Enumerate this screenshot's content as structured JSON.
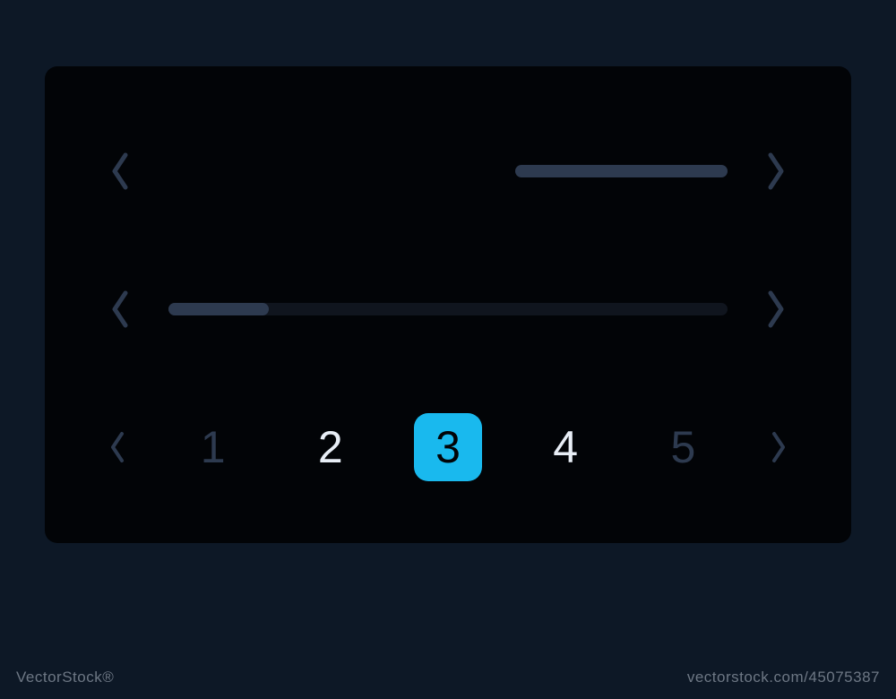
{
  "colors": {
    "page_bg": "#0d1826",
    "panel_bg": "#020407",
    "muted": "#2d3a4f",
    "track": "#10151e",
    "text_light": "#e8eef6",
    "accent": "#19b9ee",
    "watermark": "#6d7784"
  },
  "slider1": {
    "segment_visible": true
  },
  "slider2": {
    "progress_percent": 18
  },
  "pagination": {
    "pages": [
      "1",
      "2",
      "3",
      "4",
      "5"
    ],
    "active_index": 2,
    "adjacent_indices": [
      1,
      3
    ]
  },
  "watermark": {
    "left": "VectorStock®",
    "right": "vectorstock.com/45075387"
  }
}
